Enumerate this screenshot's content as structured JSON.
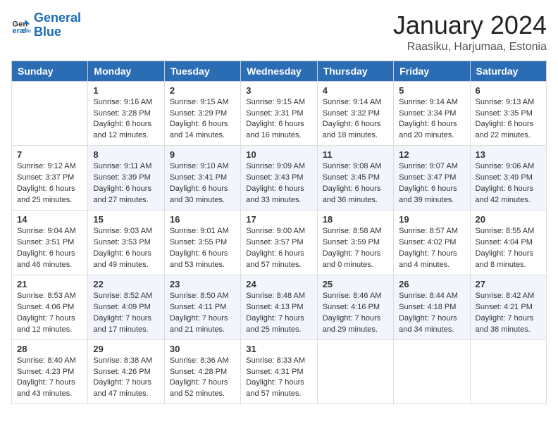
{
  "header": {
    "logo": {
      "line1": "General",
      "line2": "Blue"
    },
    "month": "January 2024",
    "location": "Raasiku, Harjumaa, Estonia"
  },
  "weekdays": [
    "Sunday",
    "Monday",
    "Tuesday",
    "Wednesday",
    "Thursday",
    "Friday",
    "Saturday"
  ],
  "weeks": [
    [
      {
        "day": "",
        "sunrise": "",
        "sunset": "",
        "daylight": ""
      },
      {
        "day": "1",
        "sunrise": "Sunrise: 9:16 AM",
        "sunset": "Sunset: 3:28 PM",
        "daylight": "Daylight: 6 hours and 12 minutes."
      },
      {
        "day": "2",
        "sunrise": "Sunrise: 9:15 AM",
        "sunset": "Sunset: 3:29 PM",
        "daylight": "Daylight: 6 hours and 14 minutes."
      },
      {
        "day": "3",
        "sunrise": "Sunrise: 9:15 AM",
        "sunset": "Sunset: 3:31 PM",
        "daylight": "Daylight: 6 hours and 16 minutes."
      },
      {
        "day": "4",
        "sunrise": "Sunrise: 9:14 AM",
        "sunset": "Sunset: 3:32 PM",
        "daylight": "Daylight: 6 hours and 18 minutes."
      },
      {
        "day": "5",
        "sunrise": "Sunrise: 9:14 AM",
        "sunset": "Sunset: 3:34 PM",
        "daylight": "Daylight: 6 hours and 20 minutes."
      },
      {
        "day": "6",
        "sunrise": "Sunrise: 9:13 AM",
        "sunset": "Sunset: 3:35 PM",
        "daylight": "Daylight: 6 hours and 22 minutes."
      }
    ],
    [
      {
        "day": "7",
        "sunrise": "Sunrise: 9:12 AM",
        "sunset": "Sunset: 3:37 PM",
        "daylight": "Daylight: 6 hours and 25 minutes."
      },
      {
        "day": "8",
        "sunrise": "Sunrise: 9:11 AM",
        "sunset": "Sunset: 3:39 PM",
        "daylight": "Daylight: 6 hours and 27 minutes."
      },
      {
        "day": "9",
        "sunrise": "Sunrise: 9:10 AM",
        "sunset": "Sunset: 3:41 PM",
        "daylight": "Daylight: 6 hours and 30 minutes."
      },
      {
        "day": "10",
        "sunrise": "Sunrise: 9:09 AM",
        "sunset": "Sunset: 3:43 PM",
        "daylight": "Daylight: 6 hours and 33 minutes."
      },
      {
        "day": "11",
        "sunrise": "Sunrise: 9:08 AM",
        "sunset": "Sunset: 3:45 PM",
        "daylight": "Daylight: 6 hours and 36 minutes."
      },
      {
        "day": "12",
        "sunrise": "Sunrise: 9:07 AM",
        "sunset": "Sunset: 3:47 PM",
        "daylight": "Daylight: 6 hours and 39 minutes."
      },
      {
        "day": "13",
        "sunrise": "Sunrise: 9:06 AM",
        "sunset": "Sunset: 3:49 PM",
        "daylight": "Daylight: 6 hours and 42 minutes."
      }
    ],
    [
      {
        "day": "14",
        "sunrise": "Sunrise: 9:04 AM",
        "sunset": "Sunset: 3:51 PM",
        "daylight": "Daylight: 6 hours and 46 minutes."
      },
      {
        "day": "15",
        "sunrise": "Sunrise: 9:03 AM",
        "sunset": "Sunset: 3:53 PM",
        "daylight": "Daylight: 6 hours and 49 minutes."
      },
      {
        "day": "16",
        "sunrise": "Sunrise: 9:01 AM",
        "sunset": "Sunset: 3:55 PM",
        "daylight": "Daylight: 6 hours and 53 minutes."
      },
      {
        "day": "17",
        "sunrise": "Sunrise: 9:00 AM",
        "sunset": "Sunset: 3:57 PM",
        "daylight": "Daylight: 6 hours and 57 minutes."
      },
      {
        "day": "18",
        "sunrise": "Sunrise: 8:58 AM",
        "sunset": "Sunset: 3:59 PM",
        "daylight": "Daylight: 7 hours and 0 minutes."
      },
      {
        "day": "19",
        "sunrise": "Sunrise: 8:57 AM",
        "sunset": "Sunset: 4:02 PM",
        "daylight": "Daylight: 7 hours and 4 minutes."
      },
      {
        "day": "20",
        "sunrise": "Sunrise: 8:55 AM",
        "sunset": "Sunset: 4:04 PM",
        "daylight": "Daylight: 7 hours and 8 minutes."
      }
    ],
    [
      {
        "day": "21",
        "sunrise": "Sunrise: 8:53 AM",
        "sunset": "Sunset: 4:06 PM",
        "daylight": "Daylight: 7 hours and 12 minutes."
      },
      {
        "day": "22",
        "sunrise": "Sunrise: 8:52 AM",
        "sunset": "Sunset: 4:09 PM",
        "daylight": "Daylight: 7 hours and 17 minutes."
      },
      {
        "day": "23",
        "sunrise": "Sunrise: 8:50 AM",
        "sunset": "Sunset: 4:11 PM",
        "daylight": "Daylight: 7 hours and 21 minutes."
      },
      {
        "day": "24",
        "sunrise": "Sunrise: 8:48 AM",
        "sunset": "Sunset: 4:13 PM",
        "daylight": "Daylight: 7 hours and 25 minutes."
      },
      {
        "day": "25",
        "sunrise": "Sunrise: 8:46 AM",
        "sunset": "Sunset: 4:16 PM",
        "daylight": "Daylight: 7 hours and 29 minutes."
      },
      {
        "day": "26",
        "sunrise": "Sunrise: 8:44 AM",
        "sunset": "Sunset: 4:18 PM",
        "daylight": "Daylight: 7 hours and 34 minutes."
      },
      {
        "day": "27",
        "sunrise": "Sunrise: 8:42 AM",
        "sunset": "Sunset: 4:21 PM",
        "daylight": "Daylight: 7 hours and 38 minutes."
      }
    ],
    [
      {
        "day": "28",
        "sunrise": "Sunrise: 8:40 AM",
        "sunset": "Sunset: 4:23 PM",
        "daylight": "Daylight: 7 hours and 43 minutes."
      },
      {
        "day": "29",
        "sunrise": "Sunrise: 8:38 AM",
        "sunset": "Sunset: 4:26 PM",
        "daylight": "Daylight: 7 hours and 47 minutes."
      },
      {
        "day": "30",
        "sunrise": "Sunrise: 8:36 AM",
        "sunset": "Sunset: 4:28 PM",
        "daylight": "Daylight: 7 hours and 52 minutes."
      },
      {
        "day": "31",
        "sunrise": "Sunrise: 8:33 AM",
        "sunset": "Sunset: 4:31 PM",
        "daylight": "Daylight: 7 hours and 57 minutes."
      },
      {
        "day": "",
        "sunrise": "",
        "sunset": "",
        "daylight": ""
      },
      {
        "day": "",
        "sunrise": "",
        "sunset": "",
        "daylight": ""
      },
      {
        "day": "",
        "sunrise": "",
        "sunset": "",
        "daylight": ""
      }
    ]
  ]
}
